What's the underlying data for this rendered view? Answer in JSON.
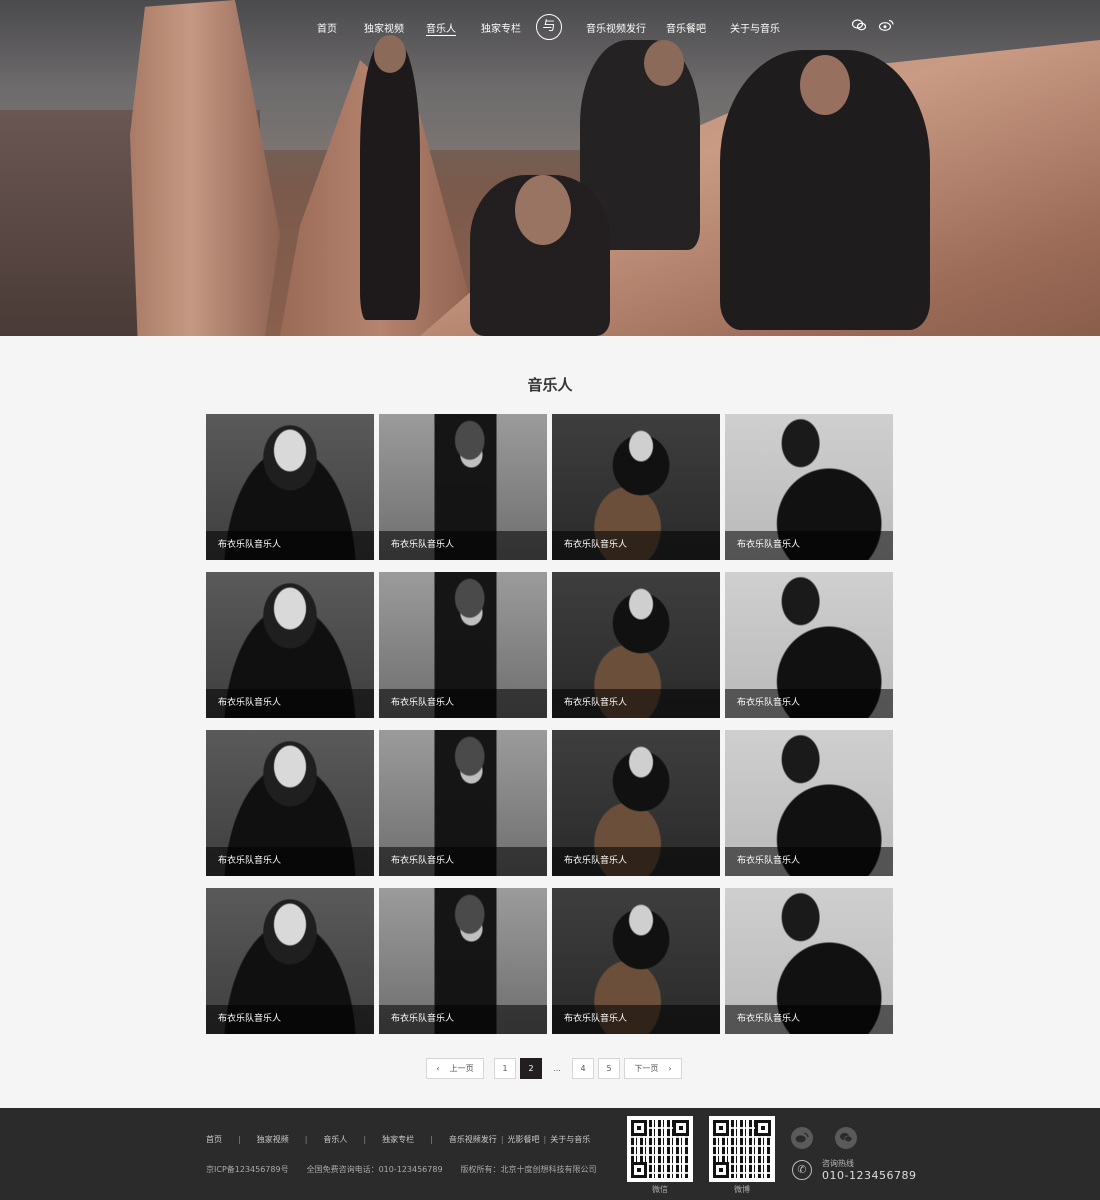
{
  "nav": {
    "items": [
      {
        "label": "首页",
        "active": false
      },
      {
        "label": "独家视频",
        "active": false
      },
      {
        "label": "音乐人",
        "active": true
      },
      {
        "label": "独家专栏",
        "active": false
      },
      {
        "label": "音乐视频发行",
        "active": false
      },
      {
        "label": "音乐餐吧",
        "active": false
      },
      {
        "label": "关于与音乐",
        "active": false
      }
    ],
    "logo_glyph": "与",
    "icons": [
      "wechat-icon",
      "weibo-icon"
    ]
  },
  "main": {
    "title": "音乐人",
    "cards": [
      {
        "caption": "布衣乐队音乐人",
        "photo": "a"
      },
      {
        "caption": "布衣乐队音乐人",
        "photo": "b"
      },
      {
        "caption": "布衣乐队音乐人",
        "photo": "c"
      },
      {
        "caption": "布衣乐队音乐人",
        "photo": "d"
      },
      {
        "caption": "布衣乐队音乐人",
        "photo": "a"
      },
      {
        "caption": "布衣乐队音乐人",
        "photo": "b"
      },
      {
        "caption": "布衣乐队音乐人",
        "photo": "c"
      },
      {
        "caption": "布衣乐队音乐人",
        "photo": "d"
      },
      {
        "caption": "布衣乐队音乐人",
        "photo": "a"
      },
      {
        "caption": "布衣乐队音乐人",
        "photo": "b"
      },
      {
        "caption": "布衣乐队音乐人",
        "photo": "c"
      },
      {
        "caption": "布衣乐队音乐人",
        "photo": "d"
      },
      {
        "caption": "布衣乐队音乐人",
        "photo": "a"
      },
      {
        "caption": "布衣乐队音乐人",
        "photo": "b"
      },
      {
        "caption": "布衣乐队音乐人",
        "photo": "c"
      },
      {
        "caption": "布衣乐队音乐人",
        "photo": "d"
      }
    ]
  },
  "pagination": {
    "prev": "上一页",
    "next": "下一页",
    "pages": [
      "1",
      "2",
      "...",
      "4",
      "5"
    ],
    "current": "2"
  },
  "footer": {
    "links": [
      "首页",
      "独家视频",
      "音乐人",
      "独家专栏",
      "音乐视频发行",
      "光影餐吧",
      "关于与音乐"
    ],
    "icp": "京ICP备123456789号",
    "phone_line": "全国免费咨询电话：010-123456789",
    "copyright": "版权所有：北京十度创想科技有限公司",
    "qr_wechat_label": "微信",
    "qr_weibo_label": "微博",
    "hotline_label": "咨询热线",
    "hotline_number": "010-123456789"
  },
  "colors": {
    "footer_bg": "#2b2b2b",
    "page_bg": "#f5f5f5",
    "active_page": "#231f20"
  }
}
